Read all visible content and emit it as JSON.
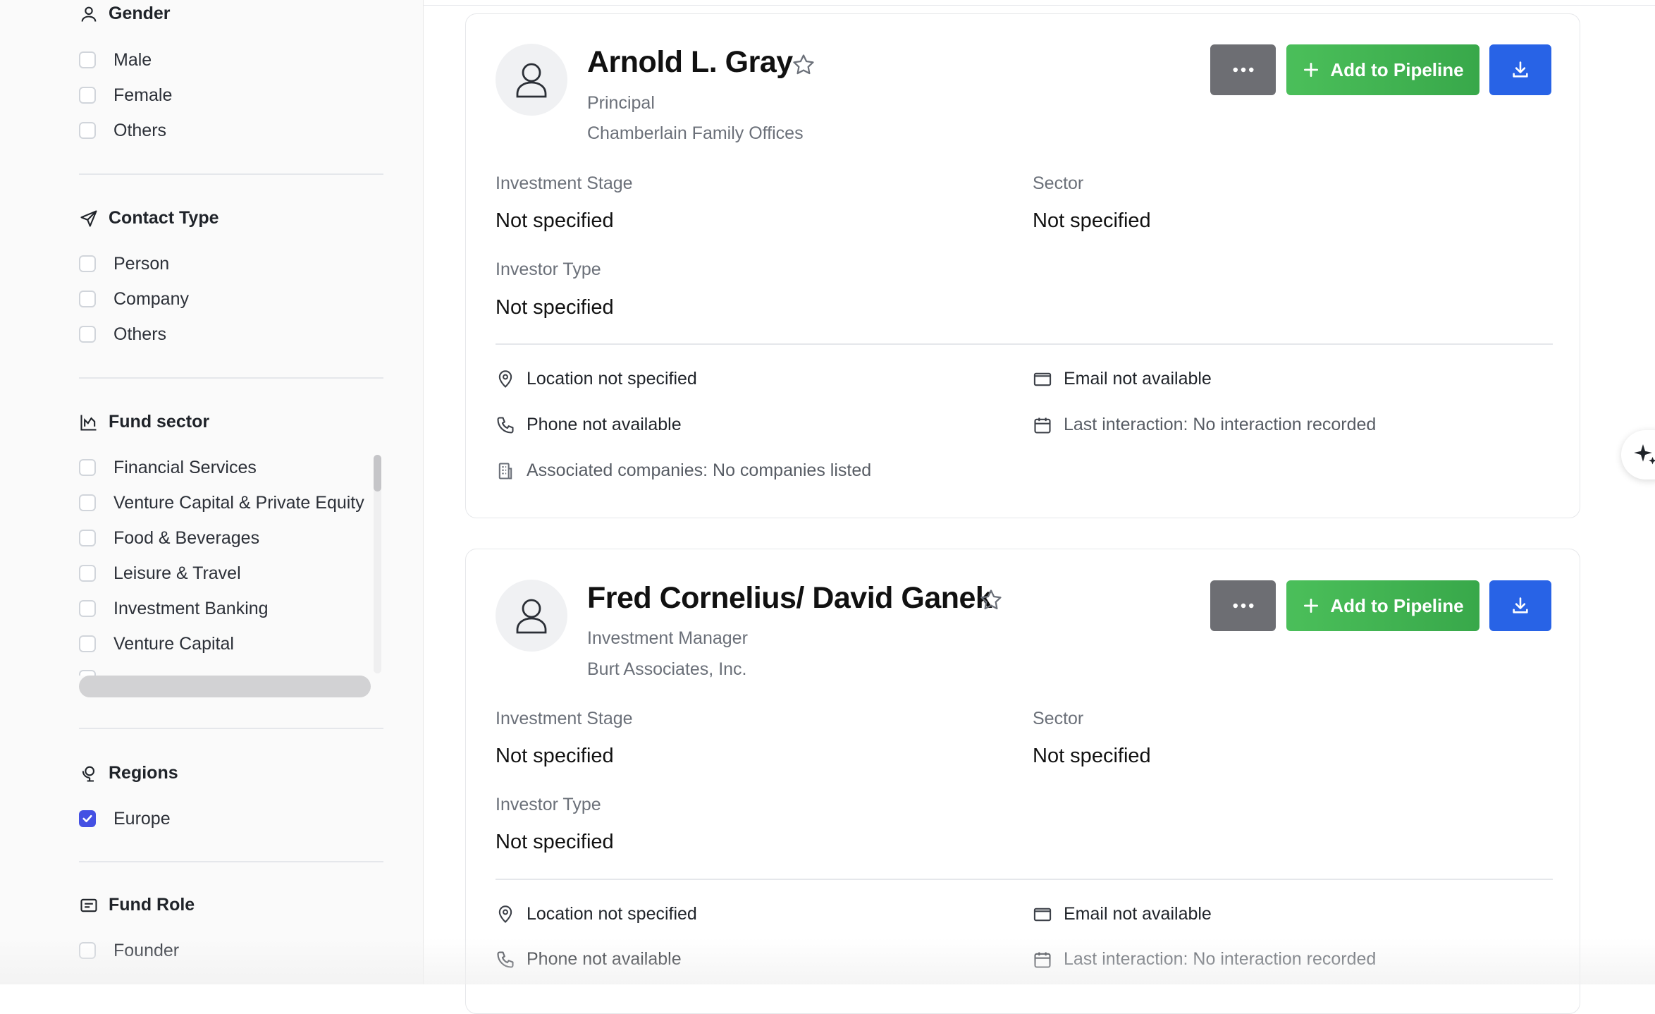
{
  "sidebar": {
    "gender": {
      "title": "Gender",
      "options": [
        "Male",
        "Female",
        "Others"
      ]
    },
    "contact_type": {
      "title": "Contact Type",
      "options": [
        "Person",
        "Company",
        "Others"
      ]
    },
    "fund_sector": {
      "title": "Fund sector",
      "options": [
        "Financial Services",
        "Venture Capital & Private Equity",
        "Food & Beverages",
        "Leisure & Travel",
        "Investment Banking",
        "Venture Capital"
      ]
    },
    "regions": {
      "title": "Regions",
      "options": [
        "Europe"
      ],
      "checked": "Europe"
    },
    "fund_role": {
      "title": "Fund Role",
      "options": [
        "Founder"
      ]
    }
  },
  "cards": [
    {
      "name": "Arnold L. Gray",
      "role": "Principal",
      "company": "Chamberlain Family Offices",
      "add_label": "Add to Pipeline",
      "investment_stage_label": "Investment Stage",
      "investment_stage": "Not specified",
      "sector_label": "Sector",
      "sector": "Not specified",
      "investor_type_label": "Investor Type",
      "investor_type": "Not specified",
      "location": "Location not specified",
      "email": "Email not available",
      "phone": "Phone not available",
      "last_interaction": "Last interaction: No interaction recorded",
      "associated": "Associated companies: No companies listed"
    },
    {
      "name": "Fred Cornelius/ David Ganek",
      "role": "Investment Manager",
      "company": "Burt Associates, Inc.",
      "add_label": "Add to Pipeline",
      "investment_stage_label": "Investment Stage",
      "investment_stage": "Not specified",
      "sector_label": "Sector",
      "sector": "Not specified",
      "investor_type_label": "Investor Type",
      "investor_type": "Not specified",
      "location": "Location not specified",
      "email": "Email not available",
      "phone": "Phone not available",
      "last_interaction": "Last interaction: No interaction recorded"
    }
  ]
}
